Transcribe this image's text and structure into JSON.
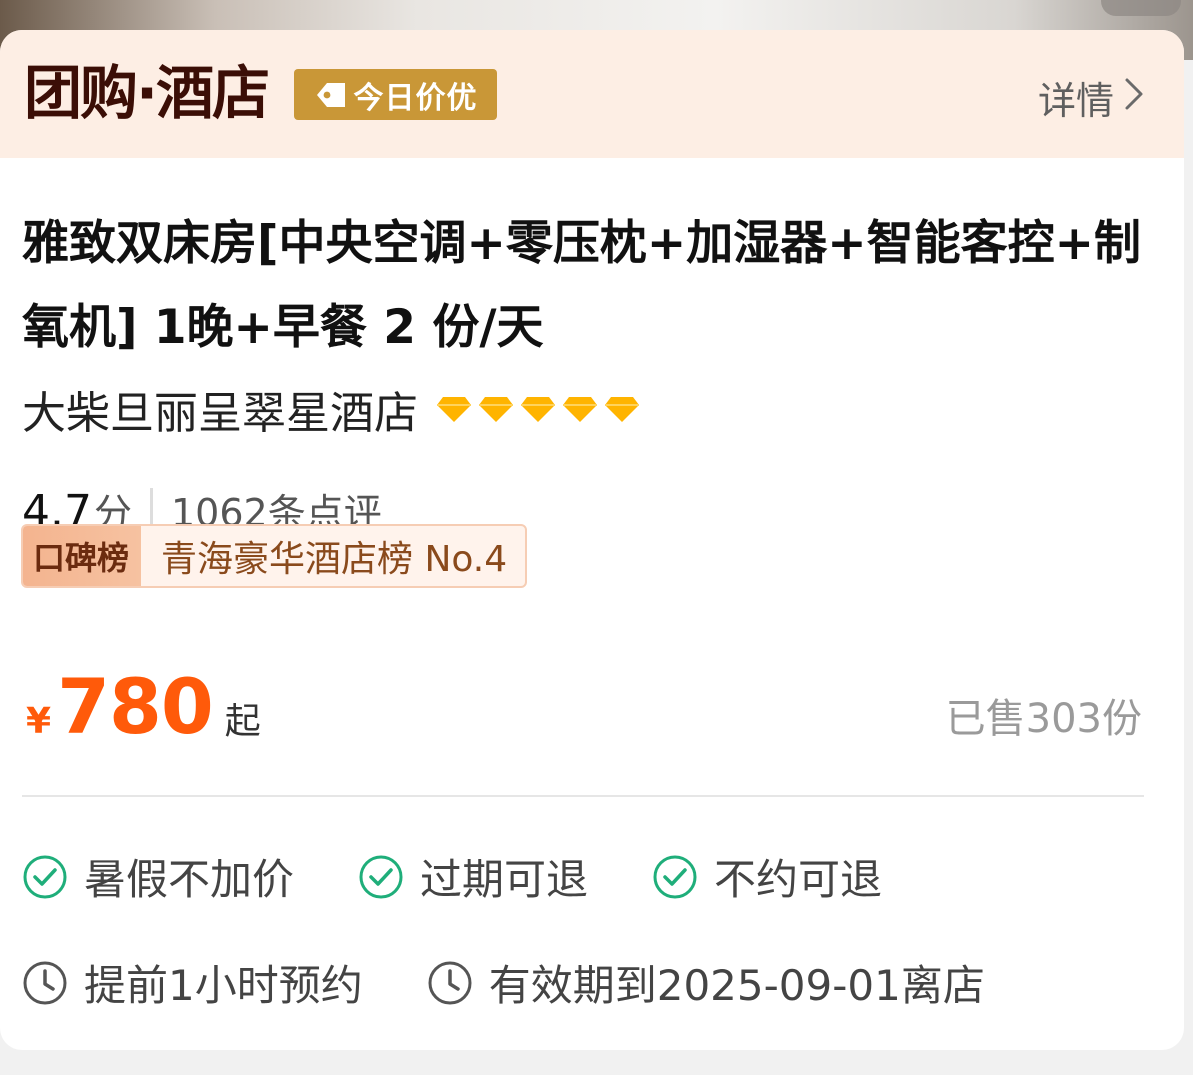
{
  "header": {
    "brand": "团购·酒店",
    "deal_badge": "今日价优",
    "details_link": "详情"
  },
  "product": {
    "room_title": "雅致双床房[中央空调+零压枕+加湿器+智能客控+制氧机] 1晚+早餐 2 份/天",
    "hotel_name": "大柴旦丽呈翠星酒店",
    "diamond_rating": 5,
    "score": "4.7",
    "score_unit": "分",
    "review_count": "1062条点评",
    "rank_badge_label": "口碑榜",
    "rank_text": "青海豪华酒店榜 No.4"
  },
  "pricing": {
    "currency": "¥",
    "price": "780",
    "price_suffix": "起",
    "sold": "已售303份"
  },
  "features": [
    {
      "label": "暑假不加价",
      "icon": "check-circle-icon"
    },
    {
      "label": "过期可退",
      "icon": "check-circle-icon"
    },
    {
      "label": "不约可退",
      "icon": "check-circle-icon"
    }
  ],
  "booking": [
    {
      "label": "提前1小时预约",
      "icon": "clock-icon"
    },
    {
      "label": "有效期到2025-09-01离店",
      "icon": "clock-icon"
    }
  ],
  "colors": {
    "accent": "#ff5a0a",
    "header_bg": "#fdeee4",
    "deal_badge_bg": "#c99737",
    "brand_text": "#3b0e06",
    "diamond": "#ffb400",
    "check": "#1fae7a"
  }
}
